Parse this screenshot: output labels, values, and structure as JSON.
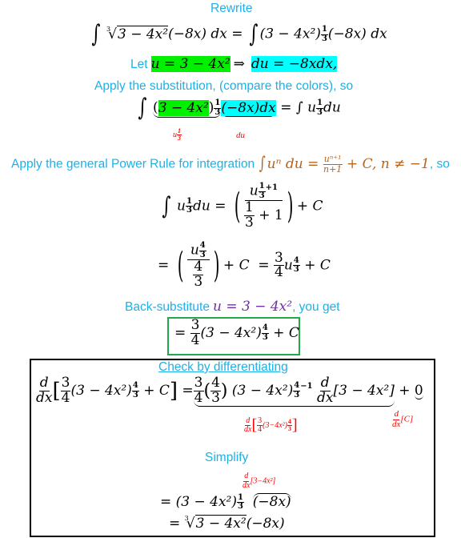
{
  "colors": {
    "note": "#1fb0e6",
    "highlight_u": "#00f000",
    "highlight_du": "#00ffff",
    "annotation": "#ff0000",
    "formula": "#b5651d",
    "backsub": "#7030a0",
    "answer_border": "#22a84a"
  },
  "step1": {
    "heading": "Rewrite",
    "lhs_radicand": "3 − 4x²",
    "lhs_index": "3",
    "lhs_factor": "(−8x) dx",
    "eq": "=",
    "rhs_base": "(3 − 4x²)",
    "rhs_exp_num": "1",
    "rhs_exp_den": "3",
    "rhs_factor": "(−8x) dx"
  },
  "step2": {
    "let_label": "Let",
    "u_def": "u = 3 − 4x²",
    "implies": "⇒",
    "du_def": "du = −8xdx,"
  },
  "step3": {
    "heading": "Apply the substitution, (compare the colors), so",
    "part_u": "3 − 4x²",
    "exp_num": "1",
    "exp_den": "3",
    "part_du": "(−8x)dx",
    "rhs": "= ∫ u",
    "rhs_du": "du",
    "label_u": "u",
    "label_u_exp_num": "1",
    "label_u_exp_den": "3",
    "label_du": "du"
  },
  "step4": {
    "heading": "Apply the general Power Rule for integration",
    "formula_lhs": "uⁿ du =",
    "formula_num": "uⁿ⁺¹",
    "formula_den": "n+1",
    "formula_tail": "+ C, n ≠ −1",
    "heading_tail": ", so",
    "line1_lhs": "u",
    "line1_du": "du =",
    "line1_num": "u",
    "line1_num_exp": "+1",
    "line1_den_tail": "+ 1",
    "plus_c": "+ C",
    "line2_eq": "=",
    "line2_num": "u",
    "line2_eq2": "=",
    "line2_coef_num": "3",
    "line2_coef_den": "4",
    "line2_u": "u"
  },
  "step5": {
    "heading_pre": "Back-substitute",
    "heading_math": "u = 3 − 4x²",
    "heading_post": ", you get",
    "answer_eq": "=",
    "answer_coef_num": "3",
    "answer_coef_den": "4",
    "answer_base": "(3 − 4x²)",
    "answer_exp_num": "4",
    "answer_exp_den": "3",
    "answer_tail": "+ C"
  },
  "check": {
    "heading": "Check by differentiating",
    "d": "d",
    "dx": "dx",
    "inner_base": "(3 − 4x²)",
    "inner_tail": "+ C",
    "rhs_eq": "=",
    "rhs_base": "(3 − 4x²)",
    "rhs_exp_tail": "−1",
    "rhs_bracket": "[3 − 4x²]",
    "plus": "+",
    "zero": "0",
    "label_term1_bracket": "(3−4x²)",
    "label_c": "[C]"
  },
  "simplify": {
    "heading": "Simplify",
    "label_bracket": "[3−4x²]",
    "line1_eq": "= (3 − 4x²)",
    "line1_factor": "(−8x)",
    "line2_eq": "=",
    "line2_index": "3",
    "line2_radicand": "3 − 4x²",
    "line2_factor": "(−8x)"
  },
  "fractions": {
    "one": "1",
    "three": "3",
    "four": "4"
  }
}
